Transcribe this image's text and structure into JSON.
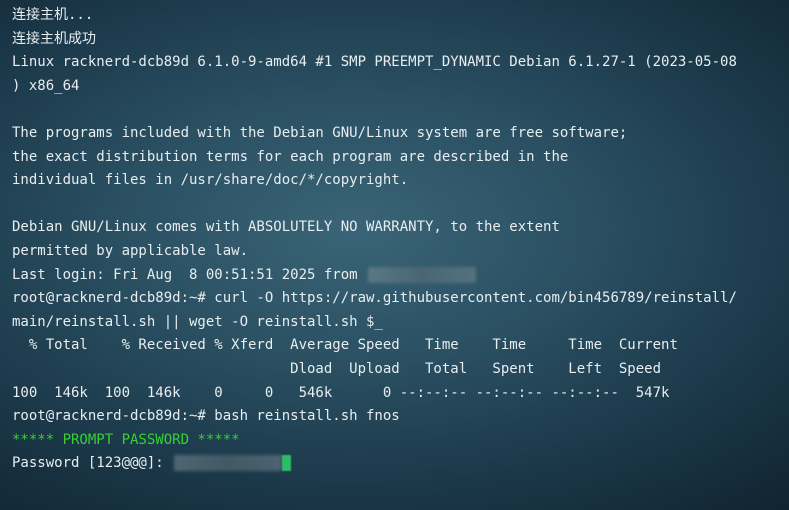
{
  "terminal": {
    "lines": [
      {
        "text": "连接主机..."
      },
      {
        "text": "连接主机成功"
      },
      {
        "text": "Linux racknerd-dcb89d 6.1.0-9-amd64 #1 SMP PREEMPT_DYNAMIC Debian 6.1.27-1 (2023-05-08"
      },
      {
        "text": ") x86_64"
      },
      {
        "text": ""
      },
      {
        "text": "The programs included with the Debian GNU/Linux system are free software;"
      },
      {
        "text": "the exact distribution terms for each program are described in the"
      },
      {
        "text": "individual files in /usr/share/doc/*/copyright."
      },
      {
        "text": ""
      },
      {
        "text": "Debian GNU/Linux comes with ABSOLUTELY NO WARRANTY, to the extent"
      },
      {
        "text": "permitted by applicable law."
      },
      {
        "text": "Last login: Fri Aug  8 00:51:51 2025 from "
      },
      {
        "text": "root@racknerd-dcb89d:~# curl -O https://raw.githubusercontent.com/bin456789/reinstall/"
      },
      {
        "text": "main/reinstall.sh || wget -O reinstall.sh $_"
      },
      {
        "text": "  % Total    % Received % Xferd  Average Speed   Time    Time     Time  Current"
      },
      {
        "text": "                                 Dload  Upload   Total   Spent    Left  Speed"
      },
      {
        "text": "100  146k  100  146k    0     0   546k      0 --:--:-- --:--:-- --:--:--  547k"
      },
      {
        "text": "root@racknerd-dcb89d:~# bash reinstall.sh fnos"
      },
      {
        "text": "***** PROMPT PASSWORD *****"
      },
      {
        "text": "Password [123@@@]: "
      }
    ]
  }
}
